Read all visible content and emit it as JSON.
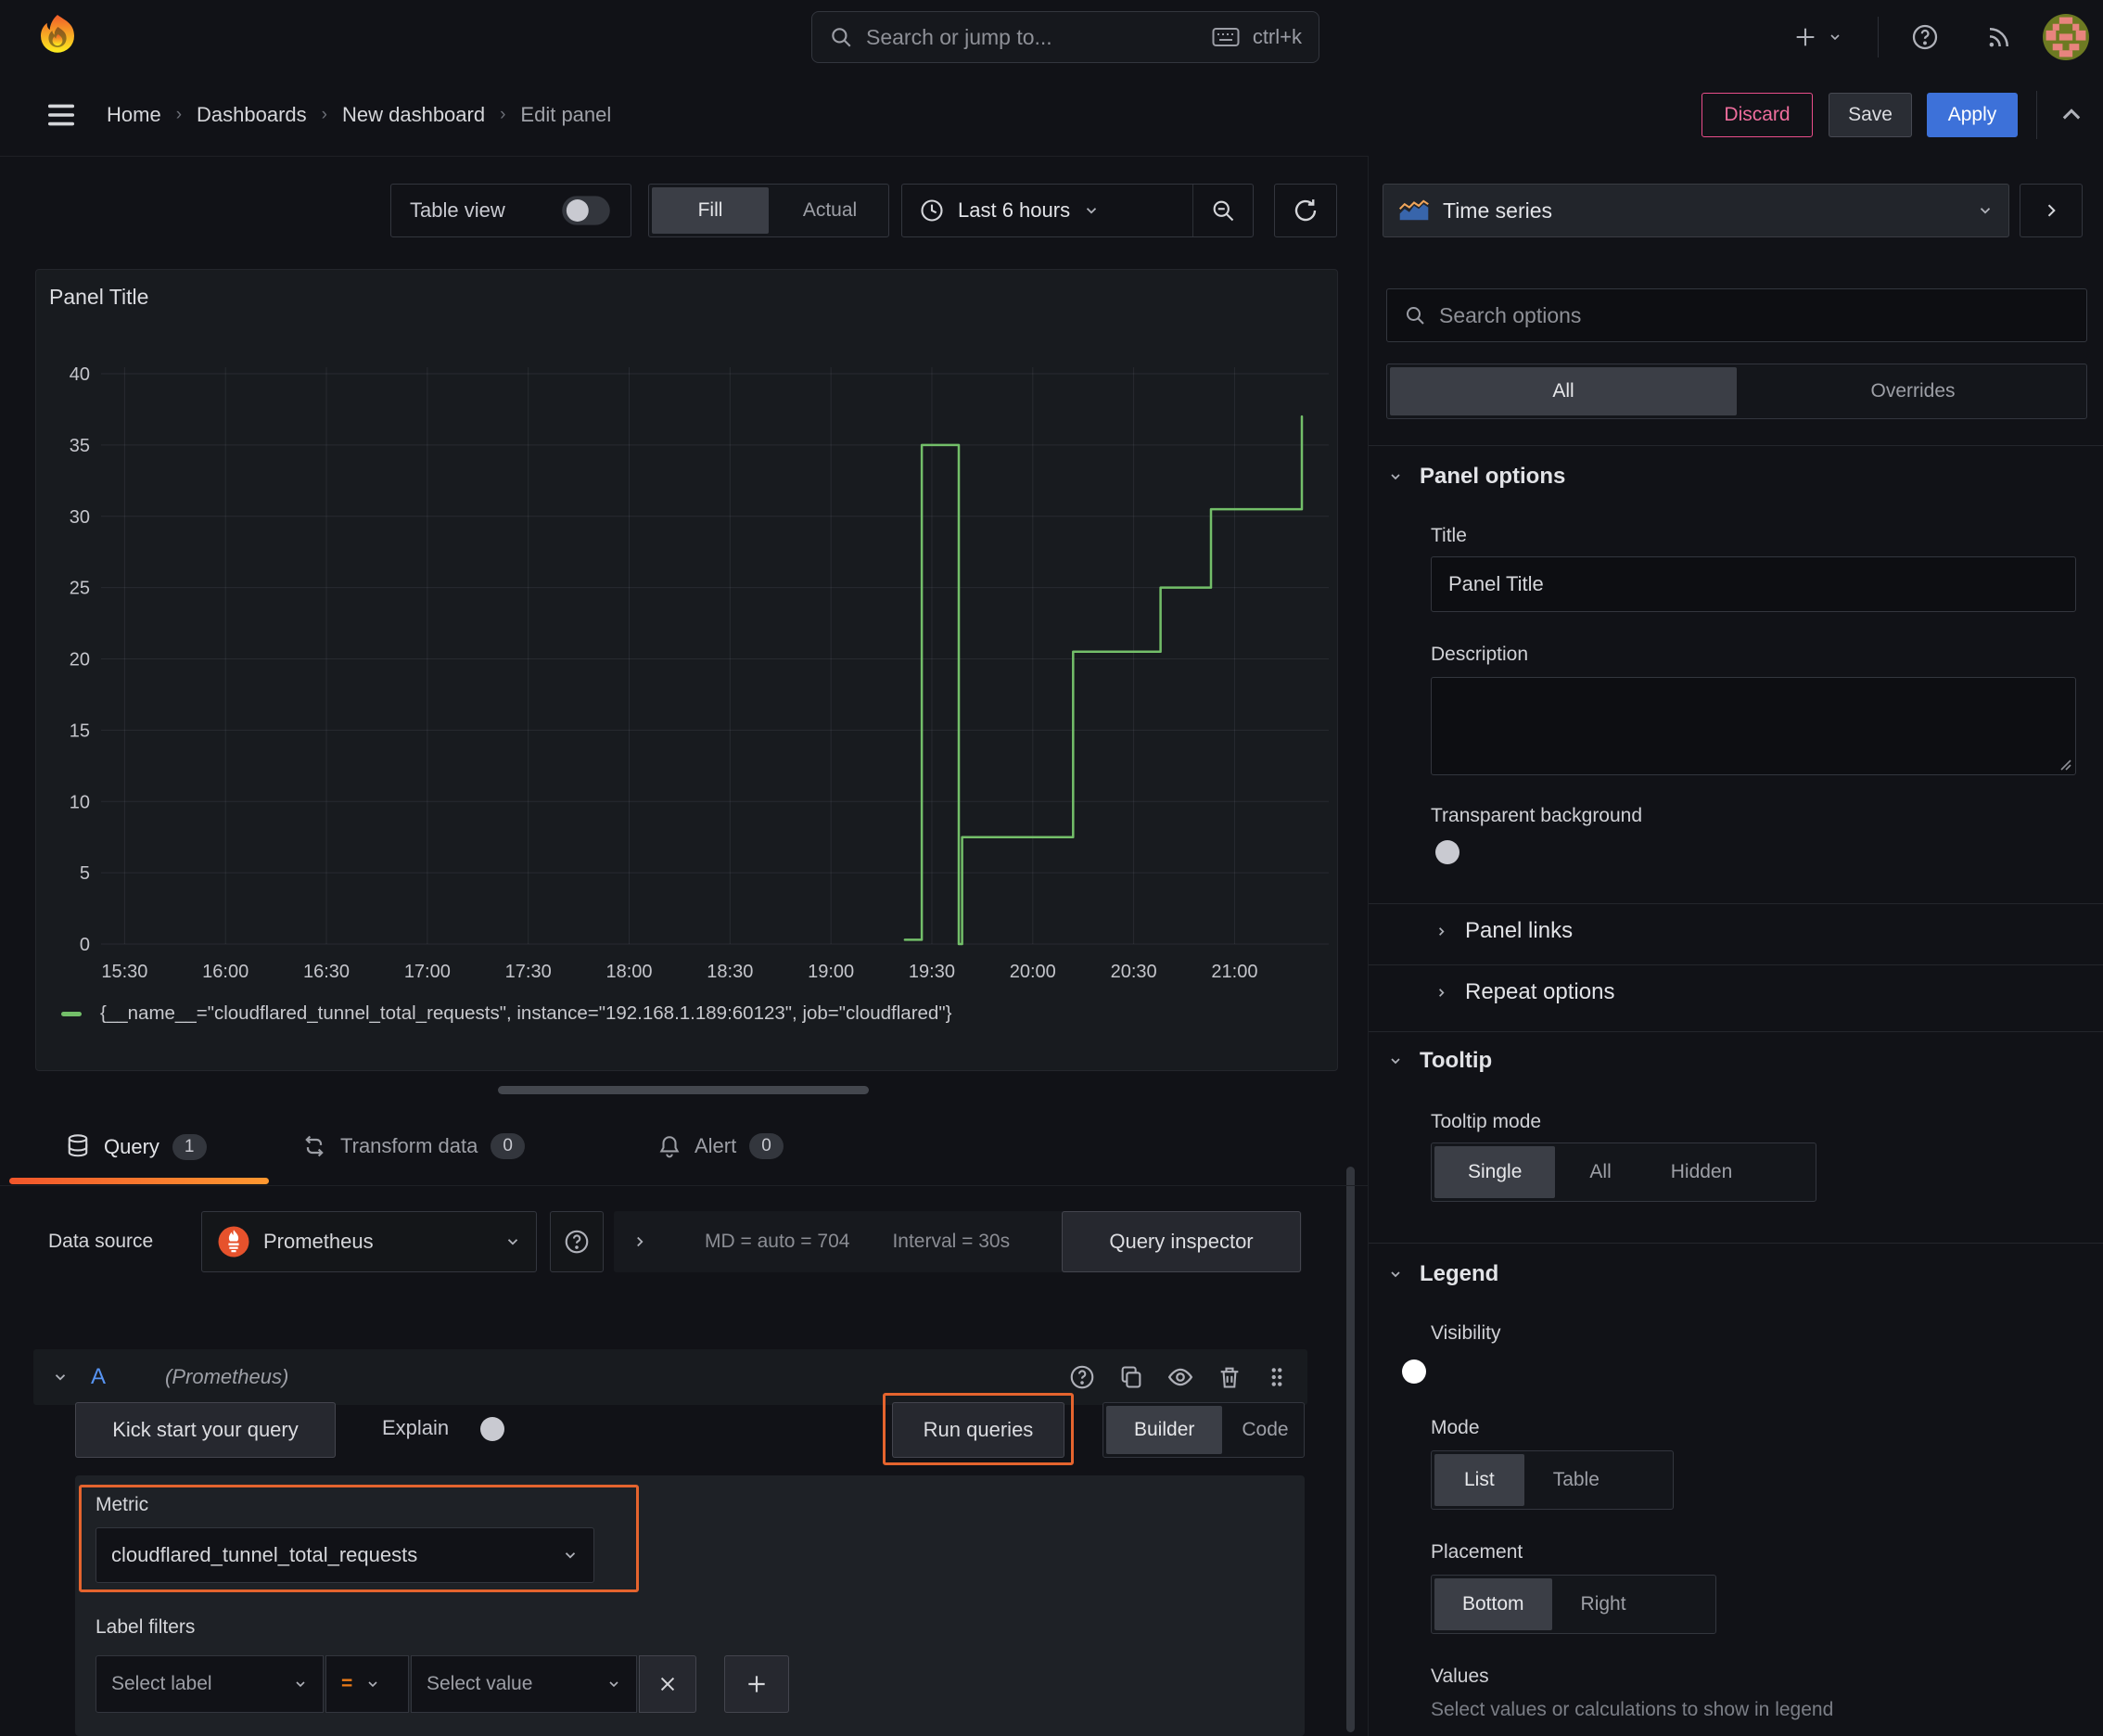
{
  "topnav": {
    "search": {
      "placeholder": "Search or jump to...",
      "shortcut": "ctrl+k"
    }
  },
  "breadcrumb": {
    "items": [
      "Home",
      "Dashboards",
      "New dashboard",
      "Edit panel"
    ]
  },
  "actions": {
    "discard": "Discard",
    "save": "Save",
    "apply": "Apply"
  },
  "viewbar": {
    "table_view": "Table view",
    "fill": "Fill",
    "actual": "Actual",
    "time_range": "Last 6 hours"
  },
  "panel": {
    "title": "Panel Title"
  },
  "chart_data": {
    "type": "line",
    "title": "Panel Title",
    "interpolation": "step",
    "grid": true,
    "legend_position": "bottom",
    "x_axis": {
      "start": "15:23",
      "end": "21:28",
      "ticks": [
        "15:30",
        "16:00",
        "16:30",
        "17:00",
        "17:30",
        "18:00",
        "18:30",
        "19:00",
        "19:30",
        "20:00",
        "20:30",
        "21:00"
      ]
    },
    "y_axis": {
      "min": 0,
      "max": 40,
      "ticks": [
        0,
        5,
        10,
        15,
        20,
        25,
        30,
        35,
        40
      ]
    },
    "series": [
      {
        "name": "{__name__=\"cloudflared_tunnel_total_requests\", instance=\"192.168.1.189:60123\", job=\"cloudflared\"}",
        "color": "#73bf69",
        "points": [
          [
            "19:22",
            0.3
          ],
          [
            "19:27",
            0.3
          ],
          [
            "19:27",
            35
          ],
          [
            "19:38",
            35
          ],
          [
            "19:38",
            0
          ],
          [
            "19:39",
            0
          ],
          [
            "19:39",
            7.5
          ],
          [
            "20:12",
            7.5
          ],
          [
            "20:12",
            20.5
          ],
          [
            "20:38",
            20.5
          ],
          [
            "20:38",
            25
          ],
          [
            "20:53",
            25
          ],
          [
            "20:53",
            30.5
          ],
          [
            "21:20",
            30.5
          ],
          [
            "21:20",
            37
          ]
        ]
      }
    ]
  },
  "tabs": [
    {
      "label": "Query",
      "count": "1"
    },
    {
      "label": "Transform data",
      "count": "0"
    },
    {
      "label": "Alert",
      "count": "0"
    }
  ],
  "datasource": {
    "label": "Data source",
    "name": "Prometheus",
    "md": "MD = auto = 704",
    "interval": "Interval = 30s",
    "inspector": "Query inspector"
  },
  "query": {
    "ref": "A",
    "hint": "(Prometheus)",
    "kick": "Kick start your query",
    "explain": "Explain",
    "run": "Run queries",
    "builder": "Builder",
    "code": "Code",
    "metric_label": "Metric",
    "metric": "cloudflared_tunnel_total_requests",
    "filters_label": "Label filters",
    "select_label": "Select label",
    "op": "=",
    "select_value": "Select value"
  },
  "sidebar": {
    "visualization": "Time series",
    "search_placeholder": "Search options",
    "filter_tabs": {
      "all": "All",
      "overrides": "Overrides"
    },
    "panel_options": {
      "title": "Panel options",
      "title_label": "Title",
      "title_value": "Panel Title",
      "description_label": "Description",
      "transparent_label": "Transparent background"
    },
    "collapsed": [
      {
        "label": "Panel links"
      },
      {
        "label": "Repeat options"
      }
    ],
    "tooltip": {
      "title": "Tooltip",
      "mode_label": "Tooltip mode",
      "options": [
        "Single",
        "All",
        "Hidden"
      ],
      "selected": "Single"
    },
    "legend": {
      "title": "Legend",
      "visibility_label": "Visibility",
      "mode_label": "Mode",
      "mode_options": [
        "List",
        "Table"
      ],
      "mode_selected": "List",
      "placement_label": "Placement",
      "placement_options": [
        "Bottom",
        "Right"
      ],
      "placement_selected": "Bottom",
      "values_label": "Values",
      "values_hint": "Select values or calculations to show in legend"
    }
  },
  "icons": {
    "grafana-logo": "flame-swirl",
    "search-icon": "magnifier",
    "keyboard-icon": "keyboard",
    "plus-icon": "+",
    "help-icon": "?",
    "rss-icon": "rss-arcs",
    "avatar": "pixel-avatar",
    "menu-icon": "hamburger",
    "clock-icon": "clock",
    "zoom-out-icon": "magnifier-minus",
    "refresh-icon": "circular-arrows",
    "database-icon": "cylinder",
    "transform-icon": "swap-arrows",
    "bell-icon": "bell",
    "prometheus-icon": "torch-flame",
    "copy-icon": "two-sheets",
    "eye-icon": "eye",
    "trash-icon": "bin",
    "drag-handle-icon": "six-dots",
    "close-icon": "x"
  },
  "colors": {
    "accent_blue": "#3d71d9",
    "accent_orange": "#e5642e",
    "tab_underline": "#f2562b",
    "series_green": "#73bf69",
    "discard_pink": "#e94d8a",
    "prometheus_orange": "#e6522c"
  }
}
